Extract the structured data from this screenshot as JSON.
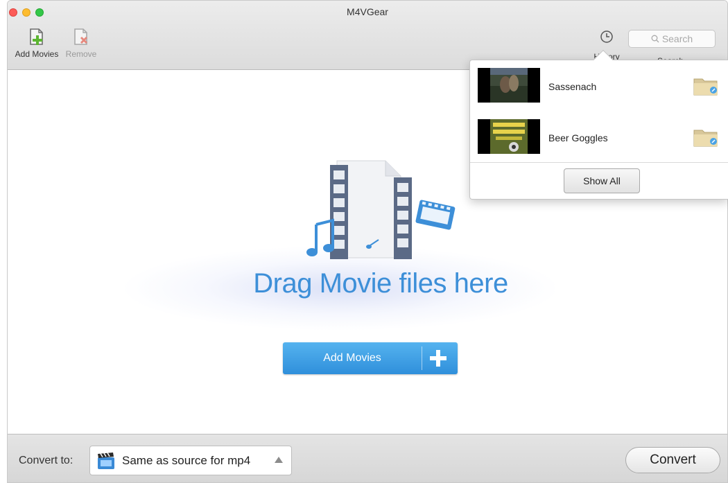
{
  "window": {
    "title": "M4VGear"
  },
  "toolbar": {
    "add_movies_label": "Add Movies",
    "remove_label": "Remove",
    "history_label": "History",
    "search_placeholder": "Search",
    "search_label": "Search"
  },
  "dropzone": {
    "prompt": "Drag Movie files here",
    "add_button_label": "Add Movies"
  },
  "footer": {
    "convert_to_label": "Convert to:",
    "format_value": "Same as source for mp4",
    "convert_button_label": "Convert"
  },
  "history_popover": {
    "items": [
      {
        "title": "Sassenach"
      },
      {
        "title": "Beer Goggles"
      }
    ],
    "show_all_label": "Show All"
  },
  "colors": {
    "accent": "#3d8fd8",
    "button_blue": "#2f8fdb"
  },
  "icons": [
    "add-movie-icon",
    "remove-movie-icon",
    "history-clock-icon",
    "search-icon",
    "film-file-icon",
    "plus-icon",
    "clapperboard-icon",
    "folder-icon"
  ]
}
